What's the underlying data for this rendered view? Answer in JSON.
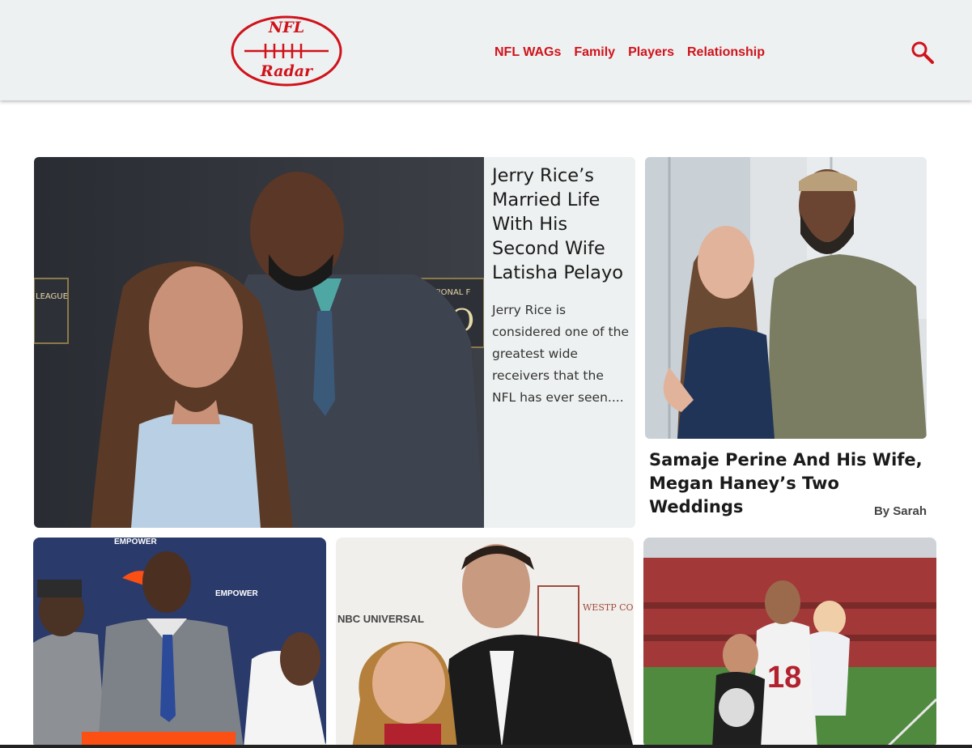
{
  "header": {
    "logo": {
      "line1": "NFL",
      "line2": "Radar"
    },
    "nav": [
      {
        "label": "NFL WAGs"
      },
      {
        "label": "Family"
      },
      {
        "label": "Players"
      },
      {
        "label": "Relationship"
      }
    ],
    "search_icon": "search-icon"
  },
  "colors": {
    "brand": "#d0121b",
    "header_bg": "#eef1f1",
    "card_bg": "#eef1f1"
  },
  "feature": {
    "title": "Jerry Rice’s Married Life With His Second Wife Latisha Pelayo",
    "excerpt": "Jerry Rice is considered one of the greatest wide receivers that the NFL has ever seen....",
    "photo_sign_left": "LEAGUE",
    "photo_sign_right_top": "NATIONAL F",
    "photo_sign_right_big": "HO"
  },
  "side": {
    "title": "Samaje Perine And His Wife, Megan Haney’s Two Weddings",
    "author": "By Sarah"
  },
  "bottom": {
    "card1_sign": "EMPOWER",
    "card2_sign_left": "NBC UNIVERSAL",
    "card2_sign_right": "WESTP COUNT PLAYHO",
    "card3_jersey": "18"
  }
}
